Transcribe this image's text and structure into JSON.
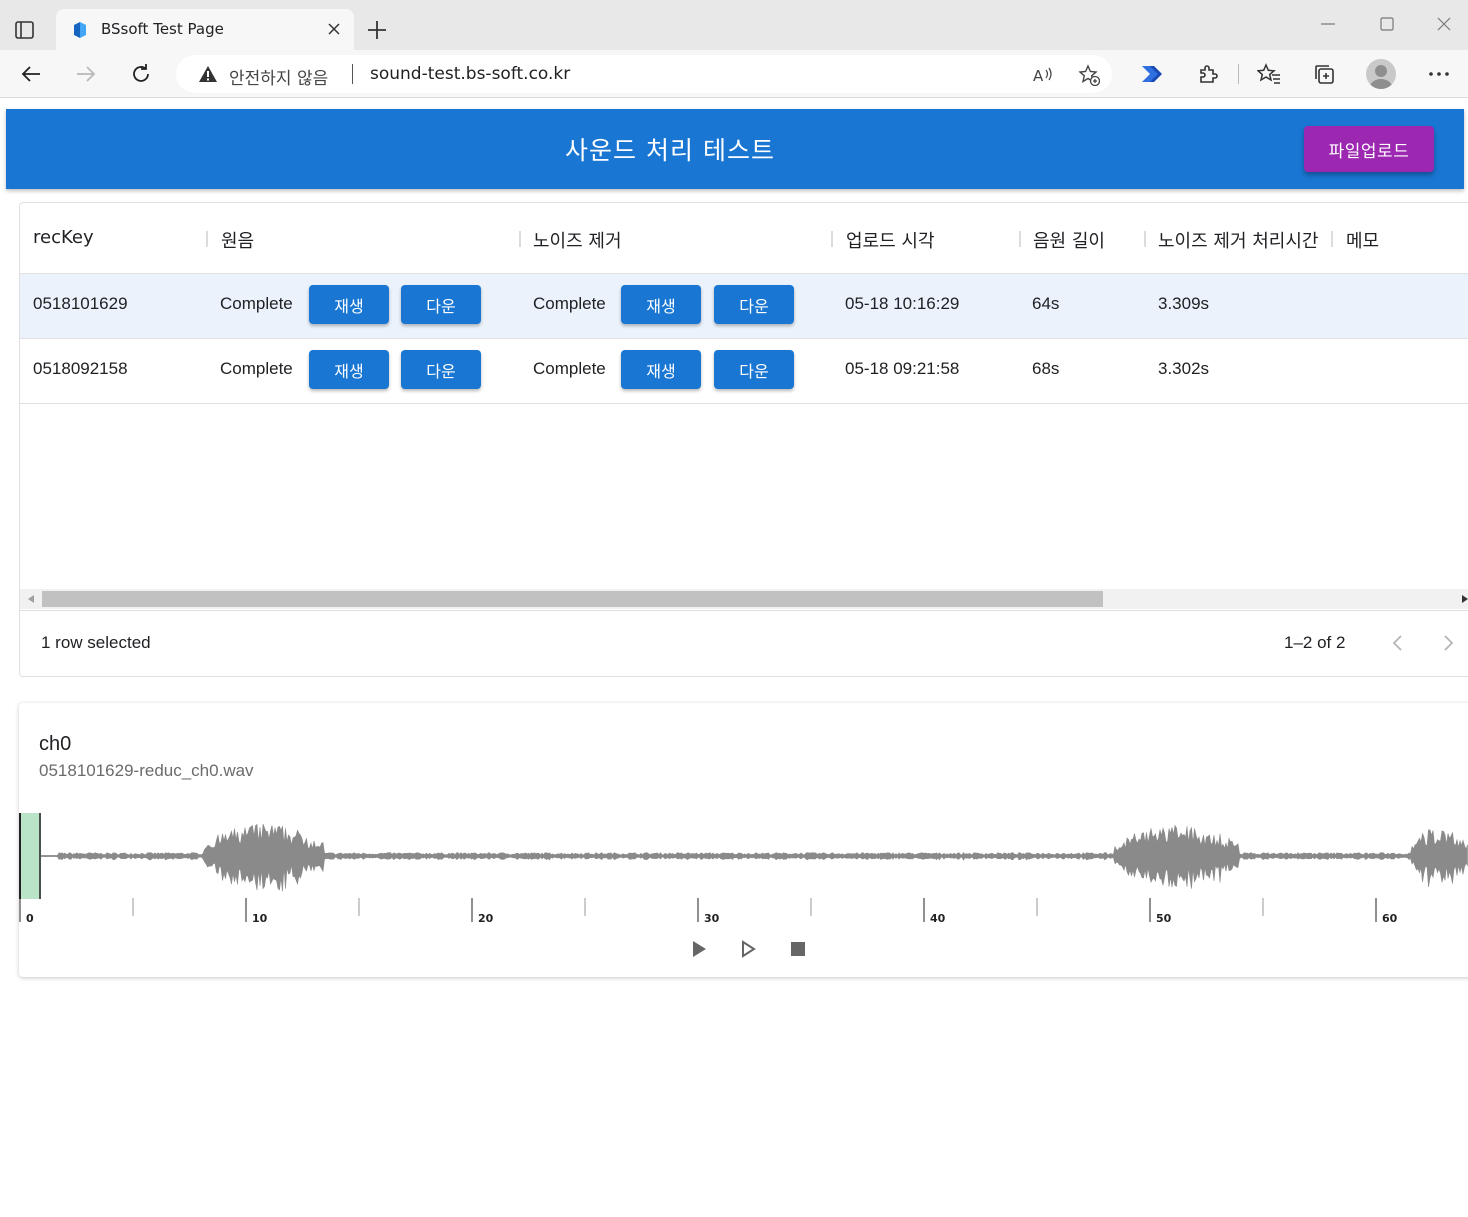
{
  "browser": {
    "tab_title": "BSsoft Test Page",
    "security_label": "안전하지 않음",
    "url": "sound-test.bs-soft.co.kr"
  },
  "app": {
    "title": "사운드 처리 테스트",
    "upload_label": "파일업로드"
  },
  "grid": {
    "columns": [
      "recKey",
      "원음",
      "노이즈 제거",
      "업로드 시각",
      "음원 길이",
      "노이즈 제거 처리시간",
      "메모"
    ],
    "rows": [
      {
        "recKey": "0518101629",
        "original_status": "Complete",
        "reduced_status": "Complete",
        "uploaded_at": "05-18 10:16:29",
        "length": "64s",
        "process_time": "3.309s",
        "memo": "",
        "selected": true
      },
      {
        "recKey": "0518092158",
        "original_status": "Complete",
        "reduced_status": "Complete",
        "uploaded_at": "05-18 09:21:58",
        "length": "68s",
        "process_time": "3.302s",
        "memo": "",
        "selected": false
      }
    ],
    "play_label": "재생",
    "download_label": "다운",
    "selected_text": "1 row selected",
    "page_range": "1–2 of 2"
  },
  "player": {
    "channel": "ch0",
    "file": "0518101629-reduc_ch0.wav",
    "timeline_labels": [
      "0",
      "10",
      "20",
      "30",
      "40",
      "50",
      "60"
    ]
  },
  "colors": {
    "primary": "#1976d2",
    "upload": "#9c27b0",
    "waveform": "#8a8a8a",
    "playhead_region": "#b9e4c7"
  },
  "icons": [
    "sidebar-icon",
    "bssoft-logo-icon",
    "close-icon",
    "plus-icon",
    "back-icon",
    "forward-icon",
    "refresh-icon",
    "warning-icon",
    "read-aloud-icon",
    "favorite-add-icon",
    "power-automate-icon",
    "extensions-icon",
    "favorites-icon",
    "collections-icon",
    "profile-icon",
    "more-icon",
    "chevron-left-icon",
    "chevron-right-icon",
    "play-icon",
    "play-outline-icon",
    "stop-icon"
  ]
}
